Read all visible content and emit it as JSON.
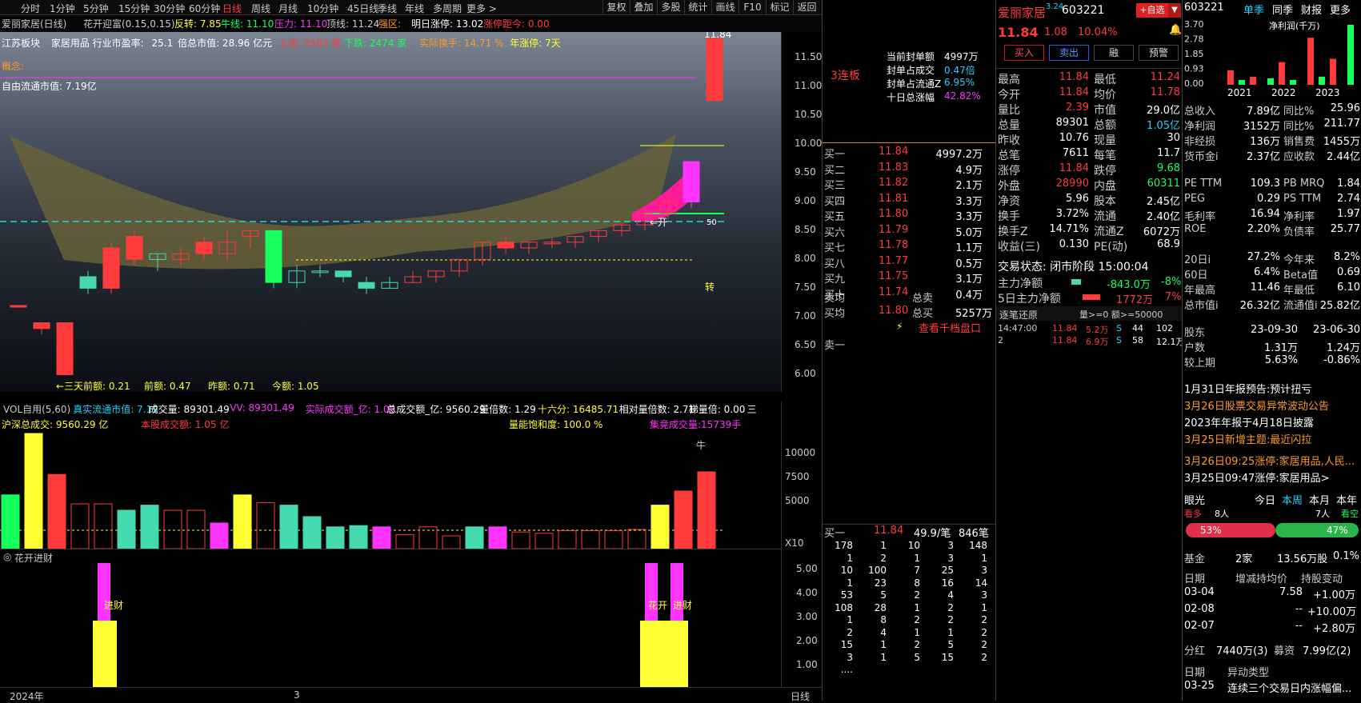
{
  "topbar": {
    "timeframes": [
      "分时",
      "1分钟",
      "5分钟",
      "15分钟",
      "30分钟",
      "60分钟",
      "日线",
      "周线",
      "月线",
      "10分钟",
      "45日线",
      "季线",
      "年线",
      "多周期",
      "更多 >"
    ],
    "active_tf": "日线",
    "right": [
      "复权",
      "叠加",
      "多股",
      "统计",
      "画线",
      "F10",
      "标记",
      "返回"
    ]
  },
  "indicators": {
    "name": "爱丽家居(日线)",
    "formula": "花开迎富(0.15,0.15)",
    "fanzhuan": "反转: 7.85",
    "niuxian": "牛线: 11.10",
    "yali": "压力: 11.10",
    "dingxian": "顶线: 11.24",
    "qiangqu": "强区:",
    "mingri": "明日涨停: 13.02",
    "zhangting_juli": "涨停距今: 0.00"
  },
  "info": {
    "board": "江苏板块",
    "industry": "家居用品 行业市盈率:",
    "pe": "25.1",
    "total_mv": "倍总市值: 28.96 亿元",
    "up": "上涨: 2503 家",
    "down": "下跌: 2474 家",
    "turnover": "实际换手: 14.71 %",
    "limit": "年涨停: 7天",
    "concept": "概念:",
    "float_mv": "自由流通市值: 7.19亿"
  },
  "chart_data": {
    "type": "candlestick",
    "ylim": [
      5.7,
      11.95
    ],
    "price_ticks": [
      "11.50",
      "11.00",
      "10.50",
      "10.00",
      "9.50",
      "9.00",
      "8.50",
      "8.00",
      "7.50",
      "7.00",
      "6.50",
      "6.00"
    ],
    "candles": [
      [
        7.2,
        7.2,
        7.2,
        7.2
      ],
      [
        6.9,
        6.8,
        6.9,
        6.7
      ],
      [
        6.9,
        6.0,
        6.9,
        6.0
      ],
      [
        7.7,
        7.5,
        7.8,
        7.4
      ],
      [
        8.2,
        7.5,
        8.3,
        7.4
      ],
      [
        8.4,
        8.0,
        8.5,
        7.9
      ],
      [
        8.0,
        8.1,
        8.1,
        7.8
      ],
      [
        8.0,
        8.1,
        8.2,
        7.9
      ],
      [
        8.3,
        8.1,
        8.4,
        8.0
      ],
      [
        8.1,
        8.3,
        8.5,
        8.0
      ],
      [
        8.4,
        8.5,
        8.5,
        8.2
      ],
      [
        8.5,
        7.6,
        8.5,
        7.5
      ],
      [
        7.6,
        7.8,
        7.9,
        7.5
      ],
      [
        7.8,
        7.8,
        7.9,
        7.7
      ],
      [
        7.8,
        7.7,
        7.8,
        7.6
      ],
      [
        7.6,
        7.5,
        7.7,
        7.4
      ],
      [
        7.5,
        7.6,
        7.7,
        7.5
      ],
      [
        7.6,
        7.7,
        7.8,
        7.6
      ],
      [
        7.7,
        7.8,
        7.8,
        7.6
      ],
      [
        7.8,
        8.0,
        8.0,
        7.7
      ],
      [
        8.0,
        8.3,
        8.3,
        7.9
      ],
      [
        8.3,
        8.2,
        8.4,
        8.1
      ],
      [
        8.2,
        8.3,
        8.3,
        8.1
      ],
      [
        8.3,
        8.3,
        8.4,
        8.2
      ],
      [
        8.3,
        8.4,
        8.4,
        8.2
      ],
      [
        8.4,
        8.5,
        8.5,
        8.3
      ],
      [
        8.5,
        8.6,
        8.6,
        8.4
      ],
      [
        8.6,
        8.8,
        8.8,
        8.5
      ],
      [
        8.8,
        9.0,
        9.1,
        8.7
      ],
      [
        9.0,
        9.7,
        9.7,
        8.9
      ],
      [
        10.76,
        11.84,
        11.84,
        10.76
      ]
    ],
    "down_idx": [
      1,
      2,
      3,
      6,
      11,
      12,
      13,
      14,
      15,
      16
    ],
    "labels": {
      "hi": "11.84",
      "bottom": "←三天前额: 0.21",
      "p1": "前额: 0.47",
      "p2": "昨额: 0.71",
      "p3": "今额: 1.05",
      "jian": "⇐开",
      "zhuan": "转",
      "lvl": "50"
    }
  },
  "vol": {
    "hdr": [
      [
        "VOL自用(5,60)",
        "lbl"
      ],
      [
        "真实流通市值: 7.19",
        "cyn"
      ],
      [
        "成交量: 89301.49",
        "wht"
      ],
      [
        "VV: 89301.49",
        "mag"
      ],
      [
        "实际成交额_亿: 1.05",
        "mag"
      ],
      [
        "总成交额_亿: 9560.29",
        "wht"
      ],
      [
        "量倍数: 1.29",
        "wht"
      ],
      [
        "十六分: 16485.71",
        "yel"
      ],
      [
        "相对量倍数: 2.71",
        "wht"
      ],
      [
        "梯量倍: 0.00",
        "wht"
      ],
      [
        "三",
        "wht"
      ]
    ],
    "hs": "沪深总成交: 9560.29 亿",
    "bg": "本股成交额: 1.05 亿",
    "sat": "量能饱和度: 100.0 %",
    "jj": "集竞成交量:15739手",
    "ticks": [
      "10000",
      "7500",
      "5000"
    ],
    "x10": "X10",
    "niu": "牛",
    "bars": [
      0.42,
      0.9,
      0.58,
      0.35,
      0.35,
      0.3,
      0.34,
      0.3,
      0.3,
      0.2,
      0.42,
      0.36,
      0.34,
      0.25,
      0.17,
      0.18,
      0.17,
      0.11,
      0.17,
      0.1,
      0.17,
      0.17,
      0.13,
      0.12,
      0.14,
      0.14,
      0.14,
      0.15,
      0.34,
      0.45,
      0.6
    ],
    "colors": [
      "g",
      "y",
      "r",
      "r",
      "r",
      "c",
      "c",
      "r",
      "r",
      "m",
      "y",
      "r",
      "c",
      "c",
      "c",
      "c",
      "m",
      "r",
      "r",
      "r",
      "c",
      "m",
      "r",
      "r",
      "r",
      "r",
      "r",
      "r",
      "y",
      "r",
      "r"
    ]
  },
  "hk": {
    "name": "花开进财",
    "ticks": [
      "5.00",
      "4.00",
      "3.00",
      "2.00",
      "1.00"
    ],
    "l1": "进财",
    "l2": "花开",
    "l3": "进财"
  },
  "dates": {
    "y": "2024年",
    "m": "3",
    "bot": "日线"
  },
  "ob": {
    "lianban": "3连板",
    "seal": [
      [
        "当前封单额",
        "4997万",
        "wht"
      ],
      [
        "封单占成交",
        "0.47倍",
        "cyn"
      ],
      [
        "封单占流通Z",
        "6.95%",
        "cyn"
      ],
      [
        "十日总涨幅",
        "42.82%",
        "mag"
      ]
    ],
    "bids": [
      [
        "买一",
        "11.84",
        "4997.2万"
      ],
      [
        "买二",
        "11.83",
        "4.9万"
      ],
      [
        "买三",
        "11.82",
        "2.1万"
      ],
      [
        "买四",
        "11.81",
        "3.3万"
      ],
      [
        "买五",
        "11.80",
        "3.3万"
      ],
      [
        "买六",
        "11.79",
        "5.0万"
      ],
      [
        "买七",
        "11.78",
        "1.1万"
      ],
      [
        "买八",
        "11.77",
        "0.5万"
      ],
      [
        "买九",
        "11.75",
        "3.1万"
      ],
      [
        "买十",
        "11.74",
        "0.4万"
      ]
    ],
    "sj": "卖均",
    "zm": "总卖",
    "bj": "买均",
    "bjv": "11.80",
    "zb": "总买",
    "zbv": "5257万",
    "qd": "查看千档盘口",
    "s1": "卖一",
    "b1": [
      "买一",
      "11.84",
      "49.9/笔",
      "846笔"
    ],
    "grid": [
      [
        "178",
        "1",
        "10",
        "3",
        "148"
      ],
      [
        "1",
        "2",
        "1",
        "3",
        "1"
      ],
      [
        "10",
        "100",
        "7",
        "25",
        "3"
      ],
      [
        "1",
        "23",
        "8",
        "16",
        "14"
      ],
      [
        "53",
        "5",
        "2",
        "4",
        "3"
      ],
      [
        "108",
        "28",
        "1",
        "2",
        "1"
      ],
      [
        "1",
        "8",
        "2",
        "2",
        "2"
      ],
      [
        "2",
        "4",
        "1",
        "1",
        "2"
      ],
      [
        "15",
        "1",
        "2",
        "5",
        "2"
      ],
      [
        "3",
        "1",
        "5",
        "15",
        "2"
      ],
      [
        "....",
        "",
        "",
        "",
        ""
      ]
    ]
  },
  "qt": {
    "name": "爱丽家居",
    "sup": "3.24",
    "code": "603221",
    "zixuan": "+自选",
    "price": "11.84",
    "chg": "1.08",
    "pct": "10.04%",
    "buy": "买入",
    "sell": "卖出",
    "jie": "融",
    "yj": "预警",
    "rows": [
      [
        "最高",
        "11.84",
        "r",
        "最低",
        "11.24",
        "r"
      ],
      [
        "今开",
        "11.84",
        "r",
        "均价",
        "11.78",
        "r"
      ],
      [
        "量比",
        "2.39",
        "r",
        "市值",
        "29.0亿",
        "w"
      ],
      [
        "总量",
        "89301",
        "w",
        "总额",
        "1.05亿",
        "c"
      ],
      [
        "昨收",
        "10.76",
        "w",
        "现量",
        "30",
        "w"
      ],
      [
        "总笔",
        "7611",
        "w",
        "每笔",
        "11.7",
        "w"
      ],
      [
        "涨停",
        "11.84",
        "r",
        "跌停",
        "9.68",
        "g"
      ],
      [
        "外盘",
        "28990",
        "r",
        "内盘",
        "60311",
        "g"
      ],
      [
        "净资",
        "5.96",
        "w",
        "股本",
        "2.45亿",
        "w"
      ],
      [
        "换手",
        "3.72%",
        "w",
        "流通",
        "2.40亿",
        "w"
      ],
      [
        "换手Z",
        "14.71%",
        "w",
        "流通Z",
        "6072万",
        "w"
      ],
      [
        "收益(三)",
        "0.130",
        "w",
        "PE(动)",
        "68.9",
        "w"
      ]
    ],
    "zt": "交易状态: 闭市阶段 15:00:04",
    "zl": "主力净额",
    "zlv": "-843.0万",
    "zlp": "-8%",
    "zl5": "5日主力净额",
    "zl5v": "1772万",
    "zl5p": "7%",
    "zb": "逐笔还原",
    "zbf": "量>=0 额>=50000",
    "ticks": [
      [
        "14:47:00",
        "11.84",
        "5.2万",
        "S",
        "44",
        "102"
      ],
      [
        "2",
        "11.84",
        "6.9万",
        "S",
        "58",
        "12.1万"
      ]
    ]
  },
  "fd": {
    "code": "603221",
    "tabs": [
      "单季",
      "同季",
      "财报",
      "更多"
    ],
    "chart": {
      "ylabel": "净利润(千万)",
      "ticks": [
        "3.70",
        "2.78",
        "1.85",
        "0.93",
        "0.00"
      ],
      "years": [
        "2021",
        "2022",
        "2023"
      ],
      "values": [
        0.9,
        0.3,
        0.5,
        0.4,
        1.4,
        0.3,
        2.9,
        0.5,
        1.6,
        3.7
      ]
    },
    "rows": [
      [
        "总收入",
        "7.89亿",
        "同比%",
        "25.96"
      ],
      [
        "净利润",
        "3152万",
        "同比%",
        "211.77"
      ],
      [
        "非经损",
        "136万",
        "销售费",
        "1455万"
      ],
      [
        "货币金i",
        "2.37亿",
        "应收款",
        "2.44亿"
      ]
    ],
    "rows2": [
      [
        "PE TTM",
        "109.3",
        "PB MRQ",
        "1.84"
      ],
      [
        "PEG",
        "0.29",
        "PS TTM",
        "2.74"
      ],
      [
        "毛利率",
        "16.94",
        "净利率",
        "1.97"
      ],
      [
        "ROE",
        "2.20%",
        "负债率",
        "25.77"
      ]
    ],
    "rows3": [
      [
        "20日i",
        "27.2%",
        "今年来",
        "8.2%"
      ],
      [
        "60日",
        "6.4%",
        "Beta值",
        "0.69"
      ],
      [
        "年最高",
        "11.46",
        "年最低",
        "6.10"
      ],
      [
        "总市值i",
        "26.32亿",
        "流通值i",
        "25.82亿"
      ]
    ],
    "sh": [
      [
        "股东",
        "23-09-30",
        "23-06-30"
      ],
      [
        "户数",
        "1.31万",
        "1.24万"
      ],
      [
        "较上期",
        "5.63%",
        "-0.86%"
      ]
    ],
    "news": [
      [
        "1月31日年报预告:预计扭亏",
        "wht"
      ],
      [
        "3月26日股票交易异常波动公告",
        "org"
      ],
      [
        "2023年年报于4月18日披露",
        "wht"
      ],
      [
        "3月25日新增主题:最近闪拉",
        "org"
      ]
    ],
    "news2": [
      [
        "3月26日09:25涨停:家居用品,人民...",
        "org"
      ],
      [
        "3月25日09:47涨停:家居用品>",
        "wht"
      ]
    ],
    "yg": "眼光",
    "ygt": [
      "今日",
      "本周",
      "本月",
      "本年"
    ],
    "kd": "看多",
    "kdn": "8人",
    "kk": "看空",
    "kkn": "7人",
    "bull": "53%",
    "bear": "47%",
    "jj": [
      "基金",
      "2家",
      "13.56万股",
      "0.1%"
    ],
    "hold": [
      "日期",
      "增减持均价",
      "持股变动"
    ],
    "holds": [
      [
        "03-04",
        "7.58",
        "+1.00万"
      ],
      [
        "02-08",
        "--",
        "+10.00万"
      ],
      [
        "02-07",
        "--",
        "+2.80万"
      ]
    ],
    "fh": [
      "分红",
      "7440万(3)",
      "募资",
      "7.99亿(2)"
    ],
    "yd": [
      "日期",
      "异动类型"
    ],
    "ydr": [
      "03-25",
      "连续三个交易日内涨幅偏..."
    ]
  }
}
